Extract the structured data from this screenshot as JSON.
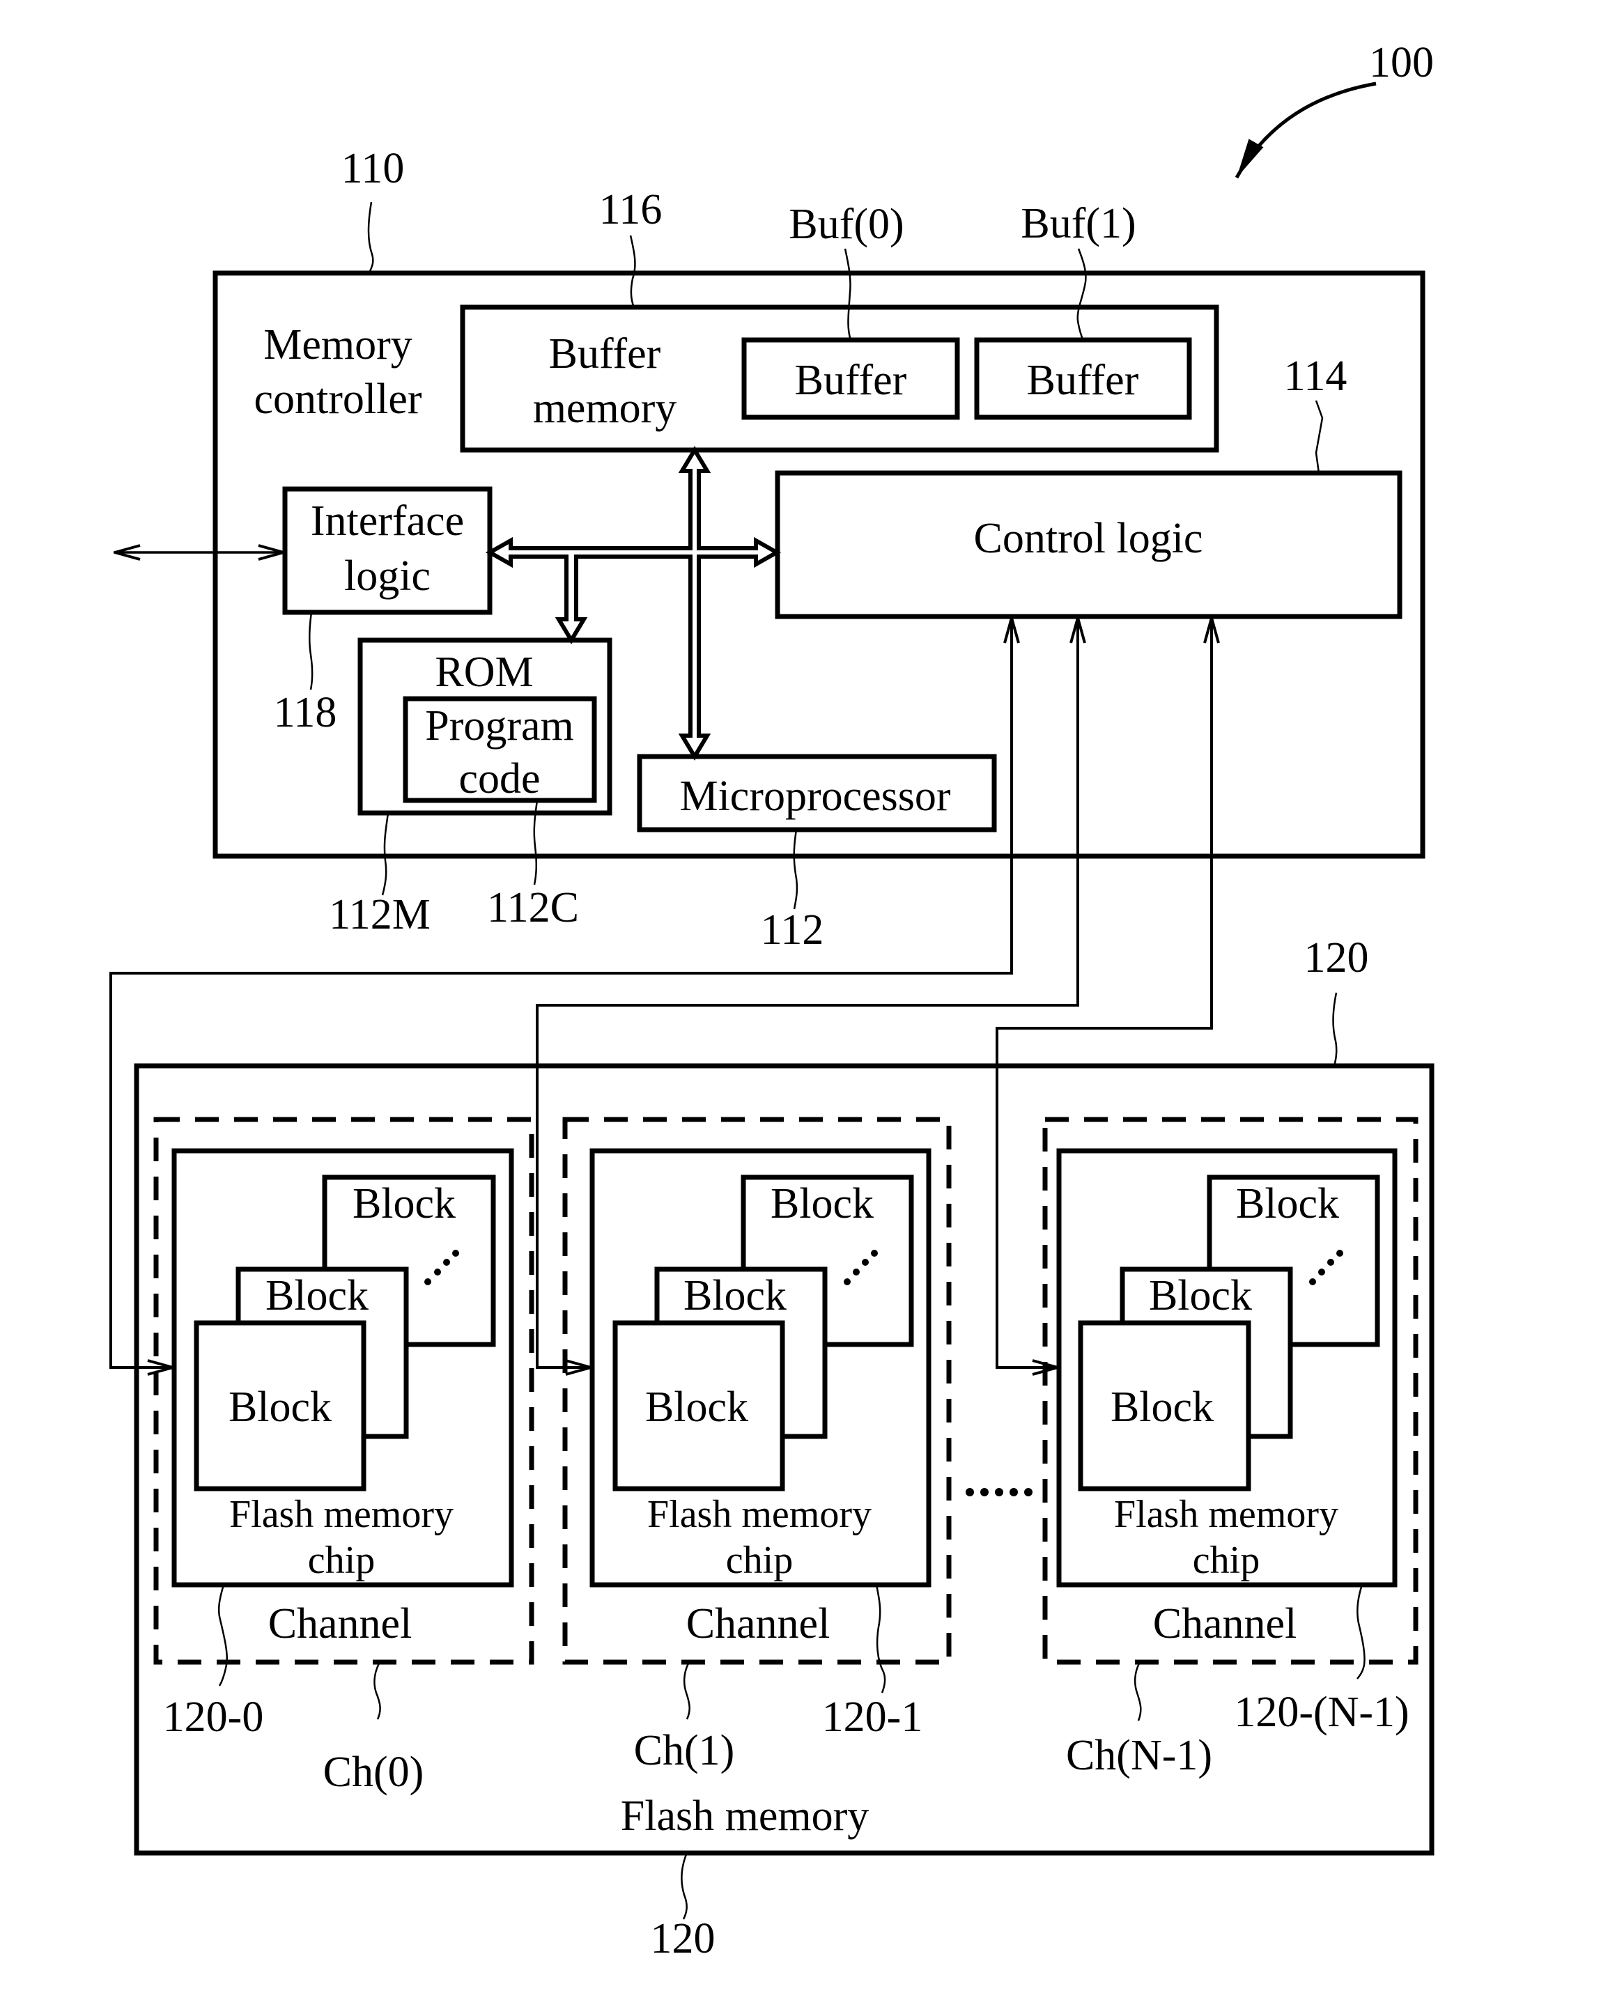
{
  "figure": {
    "ref_system": "100",
    "colors": {
      "line": "#000000",
      "background": "#ffffff"
    }
  },
  "memory_controller": {
    "ref": "110",
    "title_line1": "Memory",
    "title_line2": "controller",
    "buffer_memory": {
      "ref": "116",
      "label_line1": "Buffer",
      "label_line2": "memory",
      "buffers": [
        {
          "ref": "Buf(0)",
          "label": "Buffer"
        },
        {
          "ref": "Buf(1)",
          "label": "Buffer"
        }
      ]
    },
    "control_logic": {
      "ref": "114",
      "label": "Control logic"
    },
    "interface_logic": {
      "ref": "118",
      "label_line1": "Interface",
      "label_line2": "logic"
    },
    "rom": {
      "ref": "112M",
      "label": "ROM",
      "program_code": {
        "ref": "112C",
        "label_line1": "Program",
        "label_line2": "code"
      }
    },
    "microprocessor": {
      "ref": "112",
      "label": "Microprocessor"
    }
  },
  "flash_memory": {
    "ref_top": "120",
    "ref_bottom": "120",
    "label": "Flash memory",
    "channels": [
      {
        "channel_ref": "Ch(0)",
        "chip_ref": "120-0",
        "channel_label": "Channel",
        "chip_label_line1": "Flash memory",
        "chip_label_line2": "chip",
        "blocks": [
          "Block",
          "Block",
          "Block"
        ]
      },
      {
        "channel_ref": "Ch(1)",
        "chip_ref": "120-1",
        "channel_label": "Channel",
        "chip_label_line1": "Flash memory",
        "chip_label_line2": "chip",
        "blocks": [
          "Block",
          "Block",
          "Block"
        ]
      },
      {
        "channel_ref": "Ch(N-1)",
        "chip_ref": "120-(N-1)",
        "channel_label": "Channel",
        "chip_label_line1": "Flash memory",
        "chip_label_line2": "chip",
        "blocks": [
          "Block",
          "Block",
          "Block"
        ]
      }
    ]
  }
}
